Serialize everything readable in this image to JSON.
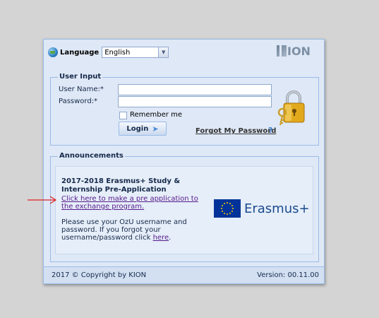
{
  "header": {
    "language_label": "Language",
    "language_value": "English",
    "logo_text": "ION",
    "logo_letter": "K"
  },
  "user_input": {
    "legend": "User Input",
    "username_label": "User Name:",
    "password_label": "Password:",
    "required_marker": "*",
    "username_value": "",
    "password_value": "",
    "remember_label": "Remember me",
    "login_label": "Login",
    "forgot_label": "Forgot My Password",
    "help_glyph": "?"
  },
  "announcements": {
    "legend": "Announcements",
    "title": "2017-2018 Erasmus+ Study & Internship Pre-Application",
    "link_text": "Click here to make a pre application to the exchange program.",
    "body_text": "Please use your OzU username and password. If you forgot your username/password click",
    "here_link": "here",
    "body_end": ".",
    "logo_text": "Erasmus+"
  },
  "footer": {
    "copyright": "2017 © Copyright by KION",
    "version": "Version: 00.11.00"
  },
  "colors": {
    "panel_bg": "#dfe8f6",
    "border": "#99bbe8",
    "text": "#15294a",
    "link_visited": "#551a8b",
    "annotation_arrow": "#e02020",
    "eu_blue": "#003399",
    "eu_gold": "#ffcc00"
  },
  "icons": [
    "globe-icon",
    "chevron-down-icon",
    "lock-icon",
    "help-icon",
    "login-arrow-icon",
    "eu-flag-icon",
    "red-arrow-annotation"
  ]
}
